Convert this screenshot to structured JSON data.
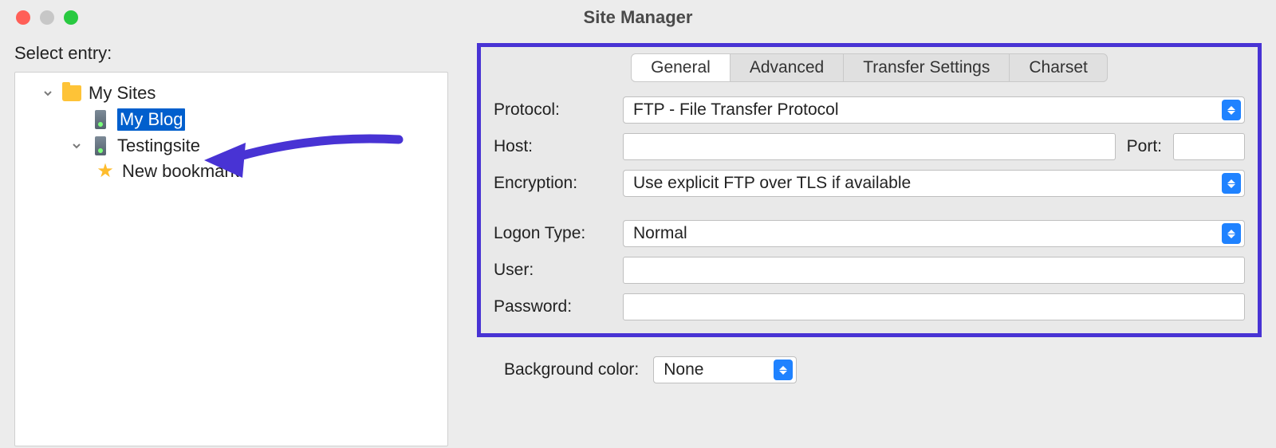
{
  "window": {
    "title": "Site Manager"
  },
  "left": {
    "label": "Select entry:",
    "tree": {
      "root": "My Sites",
      "root_children": [
        {
          "name": "My Blog",
          "selected": true
        },
        {
          "name": "Testingsite",
          "children": [
            {
              "name": "New bookmark",
              "type": "bookmark"
            }
          ]
        }
      ]
    }
  },
  "tabs": {
    "items": [
      "General",
      "Advanced",
      "Transfer Settings",
      "Charset"
    ],
    "active": "General"
  },
  "form": {
    "protocol_label": "Protocol:",
    "protocol_value": "FTP - File Transfer Protocol",
    "host_label": "Host:",
    "host_value": "",
    "port_label": "Port:",
    "port_value": "",
    "encryption_label": "Encryption:",
    "encryption_value": "Use explicit FTP over TLS if available",
    "logon_type_label": "Logon Type:",
    "logon_type_value": "Normal",
    "user_label": "User:",
    "user_value": "",
    "password_label": "Password:",
    "password_value": ""
  },
  "bg_color": {
    "label": "Background color:",
    "value": "None"
  },
  "annotation": {
    "arrow_color": "#4833d4"
  }
}
